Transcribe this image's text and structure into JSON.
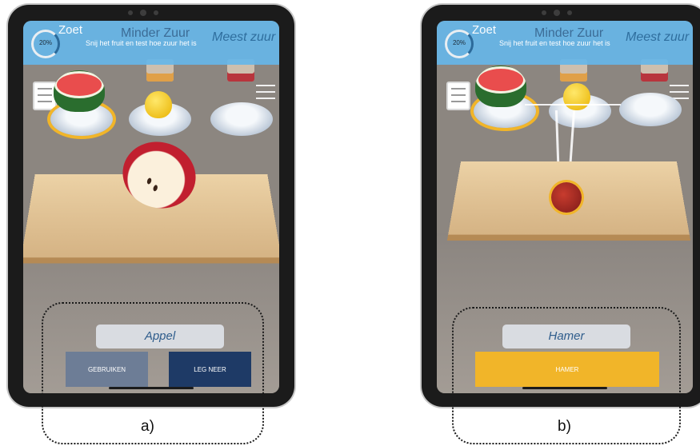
{
  "screens": {
    "a": {
      "progress": "20%",
      "categories": {
        "sweet": "Zoet",
        "less_sour": "Minder Zuur",
        "most_sour": "Meest zuur"
      },
      "instruction": "Snij het fruit en test hoe zuur het is",
      "selected_item": "Appel",
      "buttons": {
        "use": "GEBRUIKEN",
        "put_down": "LEG NEER"
      },
      "caption": "a)"
    },
    "b": {
      "progress": "20%",
      "categories": {
        "sweet": "Zoet",
        "less_sour": "Minder Zuur",
        "most_sour": "Meest zuur"
      },
      "instruction": "Snij het fruit en test hoe zuur het is",
      "selected_item": "Hamer",
      "buttons": {
        "hammer": "HAMER"
      },
      "caption": "b)"
    }
  },
  "icons": [
    "document-icon",
    "menu-icon"
  ],
  "colors": {
    "topbar": "#66b6e8",
    "use_button": "#6d7d96",
    "put_down_button": "#1e3a66",
    "hammer_button": "#f1b529",
    "selection_outline": "#f1b529"
  }
}
